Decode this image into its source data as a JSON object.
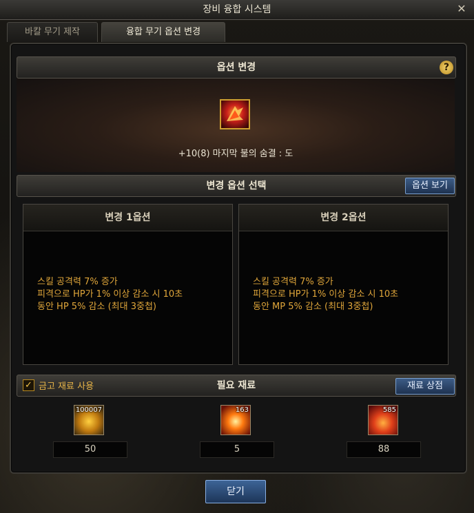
{
  "window": {
    "title": "장비 융합 시스템",
    "close_glyph": "✕"
  },
  "tabs": [
    {
      "label": "바칼 무기 제작"
    },
    {
      "label": "융합 무기 옵션 변경"
    }
  ],
  "option_change": {
    "header": "옵션 변경",
    "help_glyph": "?",
    "item_icon": "flame-dragon-weapon-icon",
    "item_name": "+10(8) 마지막 불의 숨결 : 도"
  },
  "select": {
    "header": "변경 옵션 선택",
    "view_button": "옵션 보기",
    "option1": {
      "title": "변경 1옵션",
      "lines": [
        "스킬 공격력 7% 증가",
        "피격으로 HP가 1% 이상 감소 시 10초",
        "동안 HP 5% 감소 (최대 3중첩)"
      ]
    },
    "option2": {
      "title": "변경 2옵션",
      "lines": [
        "스킬 공격력 7% 증가",
        "피격으로 HP가 1% 이상 감소 시 10초",
        "동안 MP 5% 감소 (최대 3중첩)"
      ]
    }
  },
  "materials": {
    "use_storage_label": "금고 재료 사용",
    "use_storage_checked": true,
    "header": "필요 재료",
    "shop_button": "재료 상점",
    "items": [
      {
        "icon": "gold-gem-icon",
        "owned": "100007",
        "required": "50"
      },
      {
        "icon": "fire-orb-icon",
        "owned": "163",
        "required": "5"
      },
      {
        "icon": "flame-burst-icon",
        "owned": "585",
        "required": "88"
      }
    ]
  },
  "footer": {
    "close_button": "닫기"
  },
  "colors": {
    "accent_gold": "#e0a63a",
    "button_blue": "#2d4a74"
  }
}
